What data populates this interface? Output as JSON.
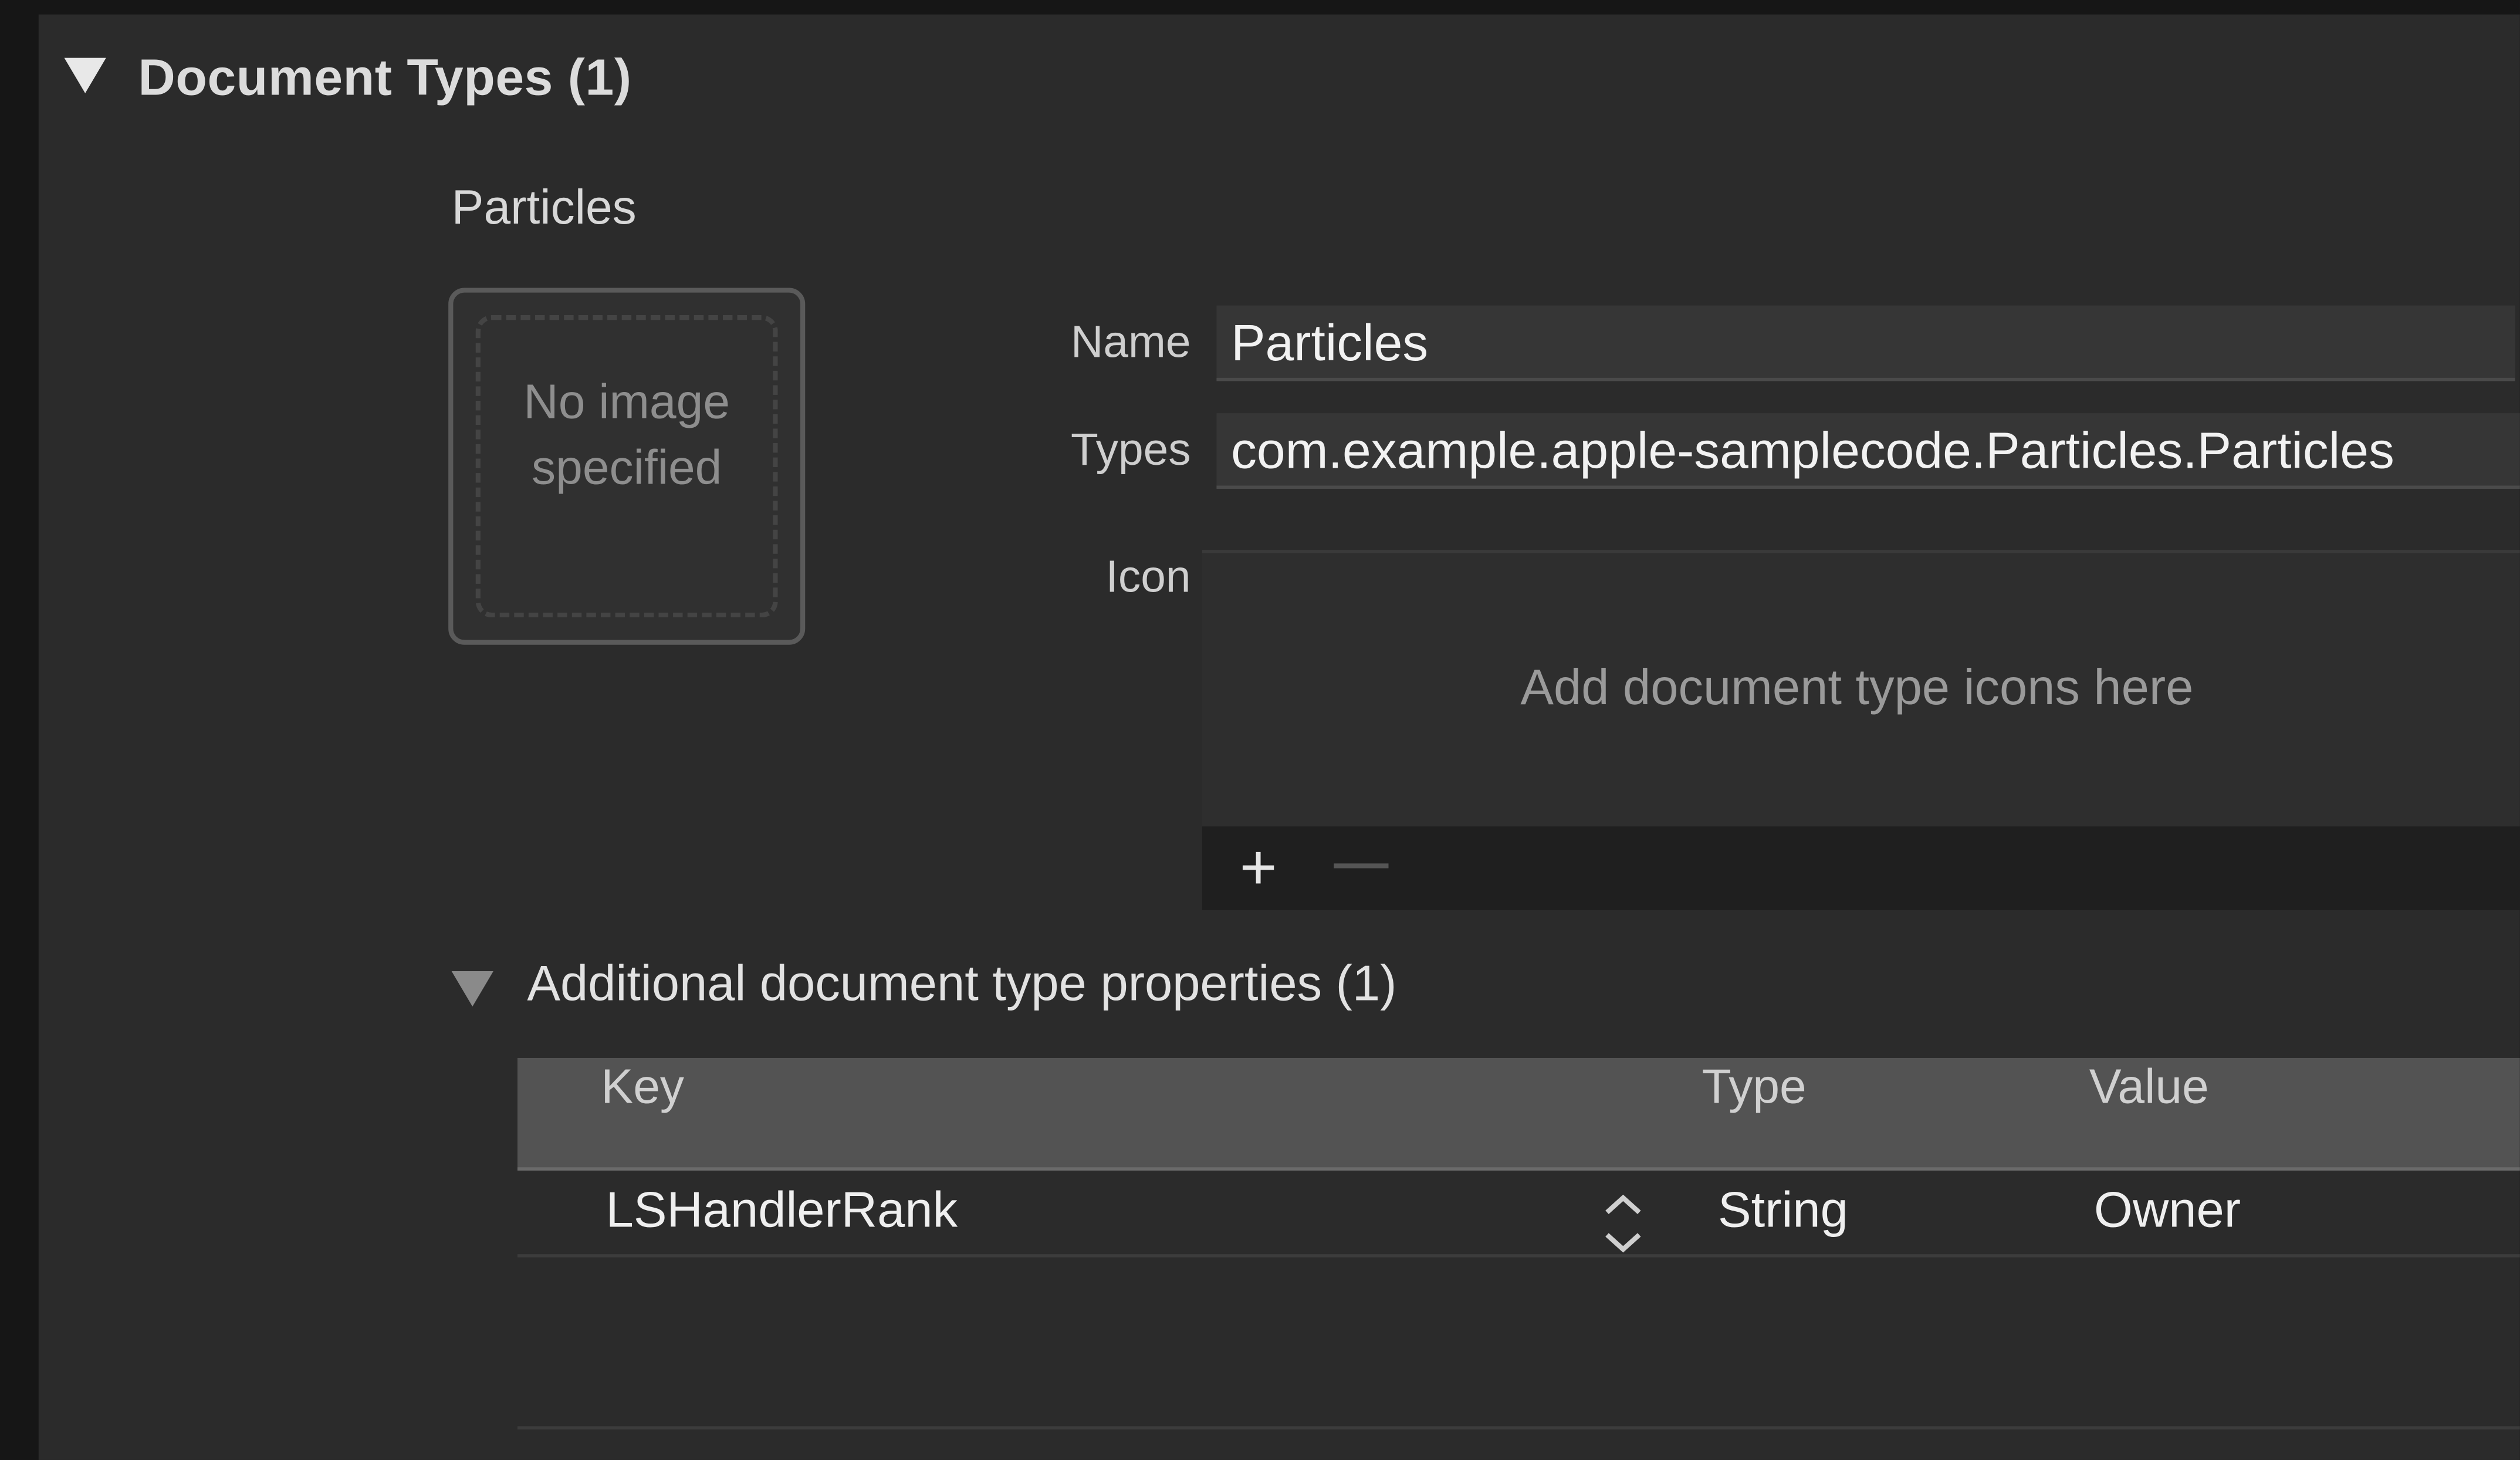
{
  "section": {
    "title": "Document Types (1)"
  },
  "document": {
    "name_heading": "Particles",
    "image_well_text": "No image specified",
    "fields": {
      "name_label": "Name",
      "name_value": "Particles",
      "types_label": "Types",
      "types_value": "com.example.apple-samplecode.Particles.Particles",
      "icon_label": "Icon"
    },
    "icon_hint": "Add document type icons here",
    "toolbar": {
      "add_icon": "plus-icon",
      "remove_icon": "minus-icon",
      "add_symbol": "+"
    }
  },
  "additional": {
    "title": "Additional document type properties (1)",
    "table": {
      "headers": [
        "Key",
        "Type",
        "Value"
      ],
      "rows": [
        {
          "key": "LSHandlerRank",
          "type": "String",
          "value": "Owner"
        }
      ]
    }
  },
  "colors": {
    "background": "#2b2b2b",
    "frame": "#161616",
    "table_header": "#535353"
  }
}
